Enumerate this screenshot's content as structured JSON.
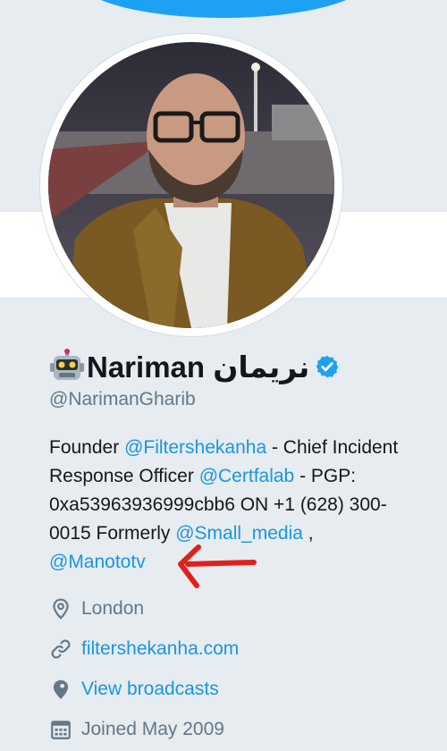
{
  "profile": {
    "name": "Nariman نريمان",
    "handle": "@NarimanGharib",
    "bio": {
      "line1_a": "Founder ",
      "line1_link": "@Filtershekanha",
      "line1_b": " - Chief Incident",
      "line2_a": "Response Officer ",
      "line2_link": "@Certfalab",
      "line2_b": " - PGP:",
      "line3": "0xa53963936999cbb6 ON +1 (628) 300-",
      "line4_a": "0015 Formerly ",
      "line4_link": "@Small_media",
      "line4_b": " ,",
      "line5_link": "@Manototv"
    },
    "location": "London",
    "website": "filtershekanha.com",
    "broadcasts": "View broadcasts",
    "joined": "Joined May 2009"
  },
  "icons": {
    "location": "location-pin-icon",
    "website": "link-icon",
    "broadcasts": "periscope-icon",
    "joined": "calendar-icon",
    "verified": "verified-badge-icon",
    "emoji": "robot-emoji-icon"
  },
  "colors": {
    "background": "#e6ecf0",
    "link": "#1b95e0",
    "secondary_text": "#657786",
    "verified": "#1da1f2",
    "annotation_arrow": "#e0201c"
  }
}
